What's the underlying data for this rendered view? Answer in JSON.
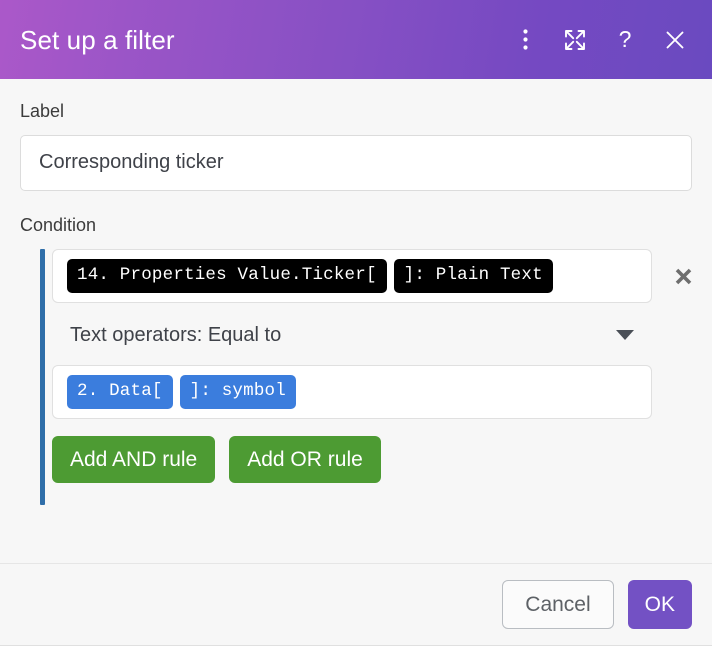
{
  "window": {
    "title": "Set up a filter",
    "gradient_start": "#ab58c9",
    "gradient_end": "#6a4ac0",
    "actions": [
      {
        "name": "more-options",
        "icon": "kebab-menu-icon",
        "label": "⋮"
      },
      {
        "name": "expand",
        "icon": "expand-icon",
        "label": "⛶"
      },
      {
        "name": "help",
        "icon": "question-mark-icon",
        "label": "?"
      },
      {
        "name": "close",
        "icon": "close-icon",
        "label": "×"
      }
    ]
  },
  "form": {
    "label_field": {
      "label": "Label",
      "value": "Corresponding ticker",
      "placeholder": "Corresponding ticker"
    },
    "condition": {
      "label": "Condition",
      "accent_color": "#2f6ea9",
      "left_operand": {
        "chips": [
          {
            "text": "14. Properties Value.Ticker[",
            "color": "#000000"
          },
          {
            "text": "]: Plain Text",
            "color": "#000000"
          }
        ],
        "remove_label": "✖"
      },
      "operator": {
        "selected": "Text operators: Equal to",
        "caret": "▼"
      },
      "right_operand": {
        "chips": [
          {
            "text": "2. Data[",
            "color": "#3b7ddd"
          },
          {
            "text": "]: symbol",
            "color": "#3b7ddd"
          }
        ]
      },
      "rule_buttons": [
        {
          "label": "Add AND rule",
          "color": "#4d9b33"
        },
        {
          "label": "Add OR rule",
          "color": "#4d9b33"
        }
      ]
    }
  },
  "footer": {
    "cancel_label": "Cancel",
    "ok_label": "OK",
    "ok_color": "#7351c4"
  }
}
